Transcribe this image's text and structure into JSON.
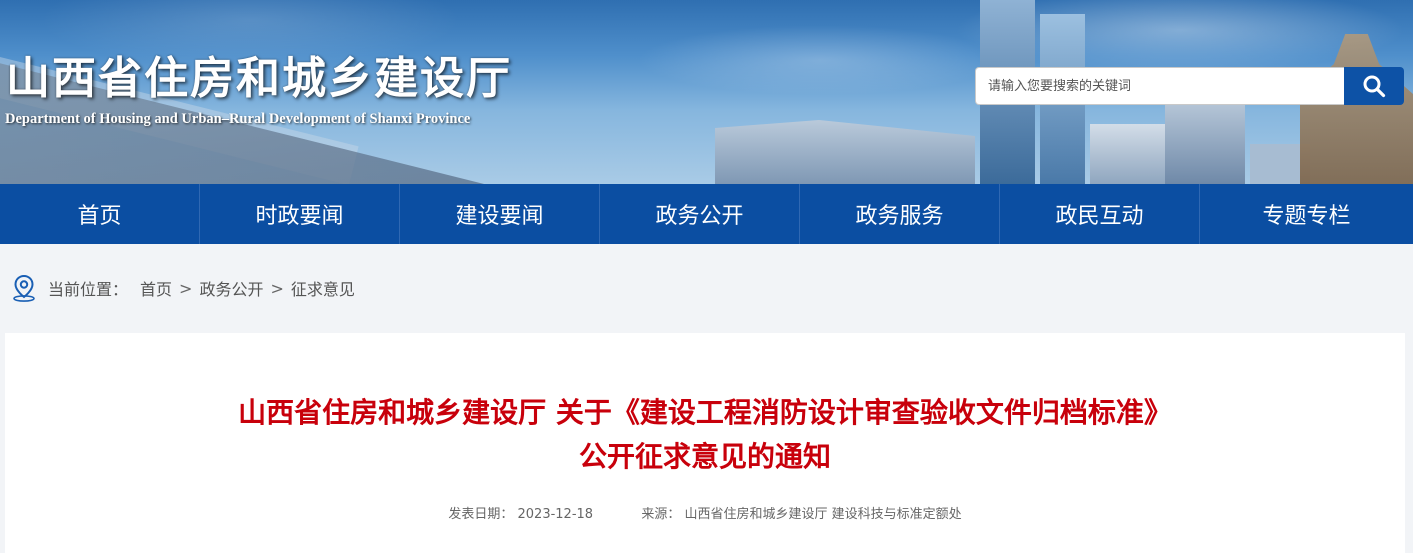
{
  "header": {
    "site_title": "山西省住房和城乡建设厅",
    "site_subtitle": "Department of Housing and Urban–Rural Development of Shanxi Province",
    "search": {
      "placeholder": "请输入您要搜索的关键词",
      "value": "",
      "button_icon": "search-icon"
    }
  },
  "nav": {
    "items": [
      {
        "label": "首页"
      },
      {
        "label": "时政要闻"
      },
      {
        "label": "建设要闻"
      },
      {
        "label": "政务公开"
      },
      {
        "label": "政务服务"
      },
      {
        "label": "政民互动"
      },
      {
        "label": "专题专栏"
      }
    ]
  },
  "breadcrumb": {
    "icon": "location-pin-icon",
    "label": "当前位置：",
    "items": [
      "首页",
      "政务公开",
      "征求意见"
    ],
    "separator": ">"
  },
  "article": {
    "title_line1": "山西省住房和城乡建设厅 关于《建设工程消防设计审查验收文件归档标准》",
    "title_line2": "公开征求意见的通知",
    "date_label": "发表日期：",
    "date": "2023-12-18",
    "source_label": "来源：",
    "source": "山西省住房和城乡建设厅 建设科技与标准定额处"
  },
  "colors": {
    "nav_bg": "#0b4ea2",
    "title_red": "#c8000b",
    "search_button": "#0d52a6"
  }
}
